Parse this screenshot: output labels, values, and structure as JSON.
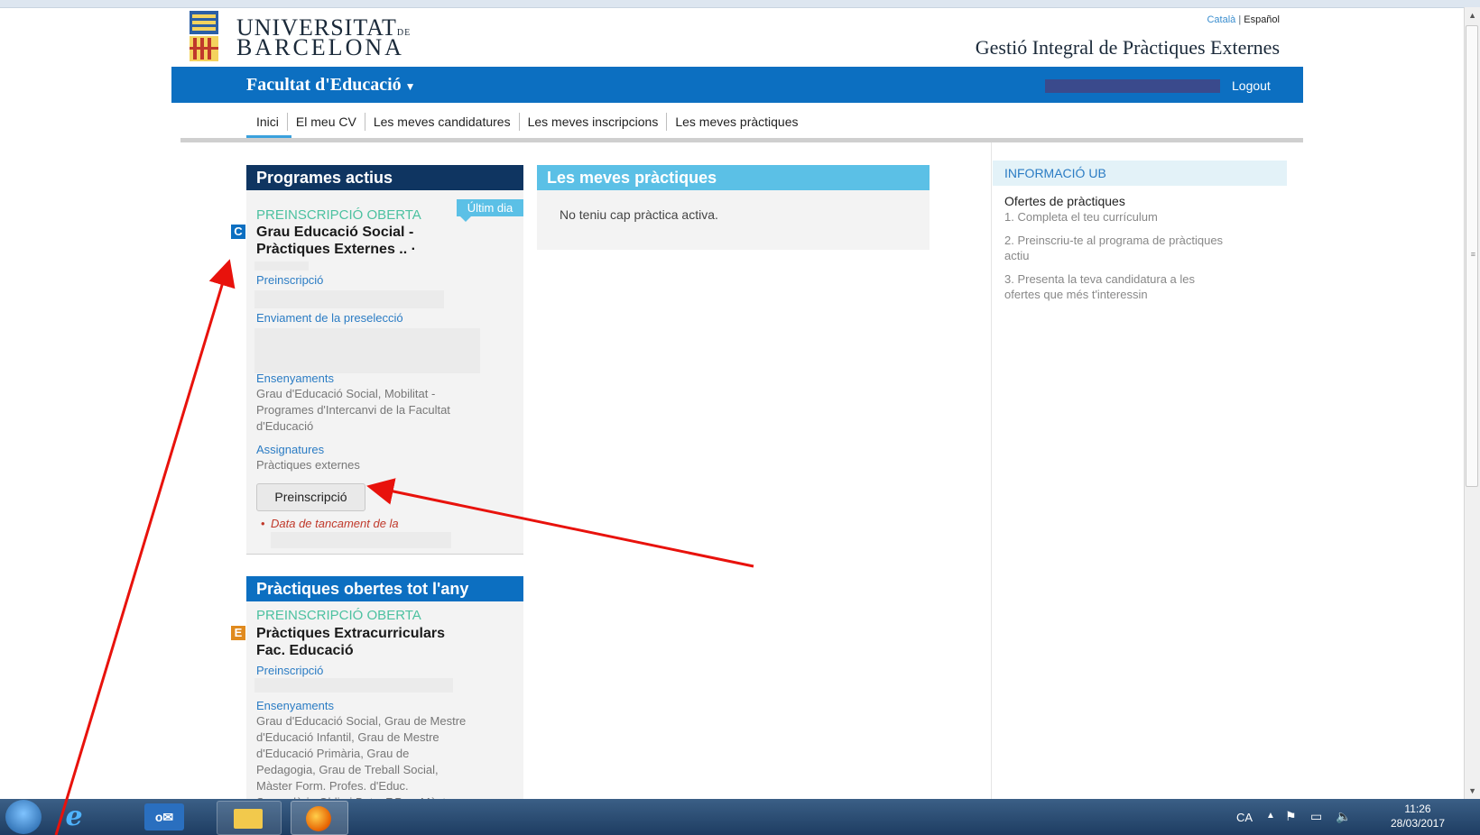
{
  "header": {
    "uni_line1": "UNIVERSITAT",
    "uni_line1_suffix": "DE",
    "uni_line2": "BARCELONA",
    "lang_catala": "Català",
    "lang_sep": "|",
    "lang_espanol": "Español",
    "site_title": "Gestió Integral de Pràctiques Externes"
  },
  "bluebar": {
    "faculty": "Facultat d'Educació",
    "caret": "▼",
    "logout": "Logout"
  },
  "menu": {
    "items": [
      {
        "label": "Inici"
      },
      {
        "label": "El meu CV"
      },
      {
        "label": "Les meves candidatures"
      },
      {
        "label": "Les meves inscripcions"
      },
      {
        "label": "Les meves pràctiques"
      }
    ]
  },
  "actius": {
    "title": "Programes actius",
    "badge_last_day": "Últim dia",
    "status": "PREINSCRIPCIÓ OBERTA",
    "type_badge": "C",
    "program_title_line1": "Grau Educació Social -",
    "program_title_line2": "Pràctiques Externes .. ·",
    "link_preinscripcio": "Preinscripció",
    "link_enviament": "Enviament de la preselecció",
    "ensenyaments_label": "Ensenyaments",
    "ensenyaments_line1": "Grau d'Educació Social, Mobilitat -",
    "ensenyaments_line2": "Programes d'Intercanvi de la Facultat",
    "ensenyaments_line3": "d'Educació",
    "assignatures_label": "Assignatures",
    "assignatures_value": "Pràctiques externes",
    "button_preinscripcio": "Preinscripció",
    "date_note": "Data de tancament de la"
  },
  "meves": {
    "title": "Les meves pràctiques",
    "empty_text": "No teniu cap pràctica activa."
  },
  "tot_any": {
    "title": "Pràctiques obertes tot l'any",
    "status": "PREINSCRIPCIÓ OBERTA",
    "type_badge": "E",
    "program_title_line1": "Pràctiques Extracurriculars",
    "program_title_line2": "Fac. Educació",
    "link_preinscripcio": "Preinscripció",
    "ensenyaments_label": "Ensenyaments",
    "ensenyaments_lines": [
      "Grau d'Educació Social, Grau de Mestre",
      "d'Educació Infantil, Grau de Mestre",
      "d'Educació Primària, Grau de",
      "Pedagogia, Grau de Treball Social,",
      "Màster Form. Profes. d'Educ.",
      "Secundària Oblig.i Batx.,F.P. ... Màster"
    ]
  },
  "info": {
    "title": "INFORMACIÓ UB",
    "subtitle": "Ofertes de pràctiques",
    "step1": "1. Completa el teu currículum",
    "step2_line1": "2. Preinscriu-te al programa de pràctiques",
    "step2_line2": "actiu",
    "step3_line1": "3. Presenta la teva candidatura a les",
    "step3_line2": "ofertes que més t'interessin"
  },
  "taskbar": {
    "lang": "CA",
    "time": "11:26",
    "date": "28/03/2017"
  },
  "colors": {
    "brand_blue": "#0c6fc1",
    "navy": "#0f3561",
    "light_blue": "#5bc0e6",
    "open_green": "#4cc1a0",
    "annotation_red": "#e8120c"
  }
}
